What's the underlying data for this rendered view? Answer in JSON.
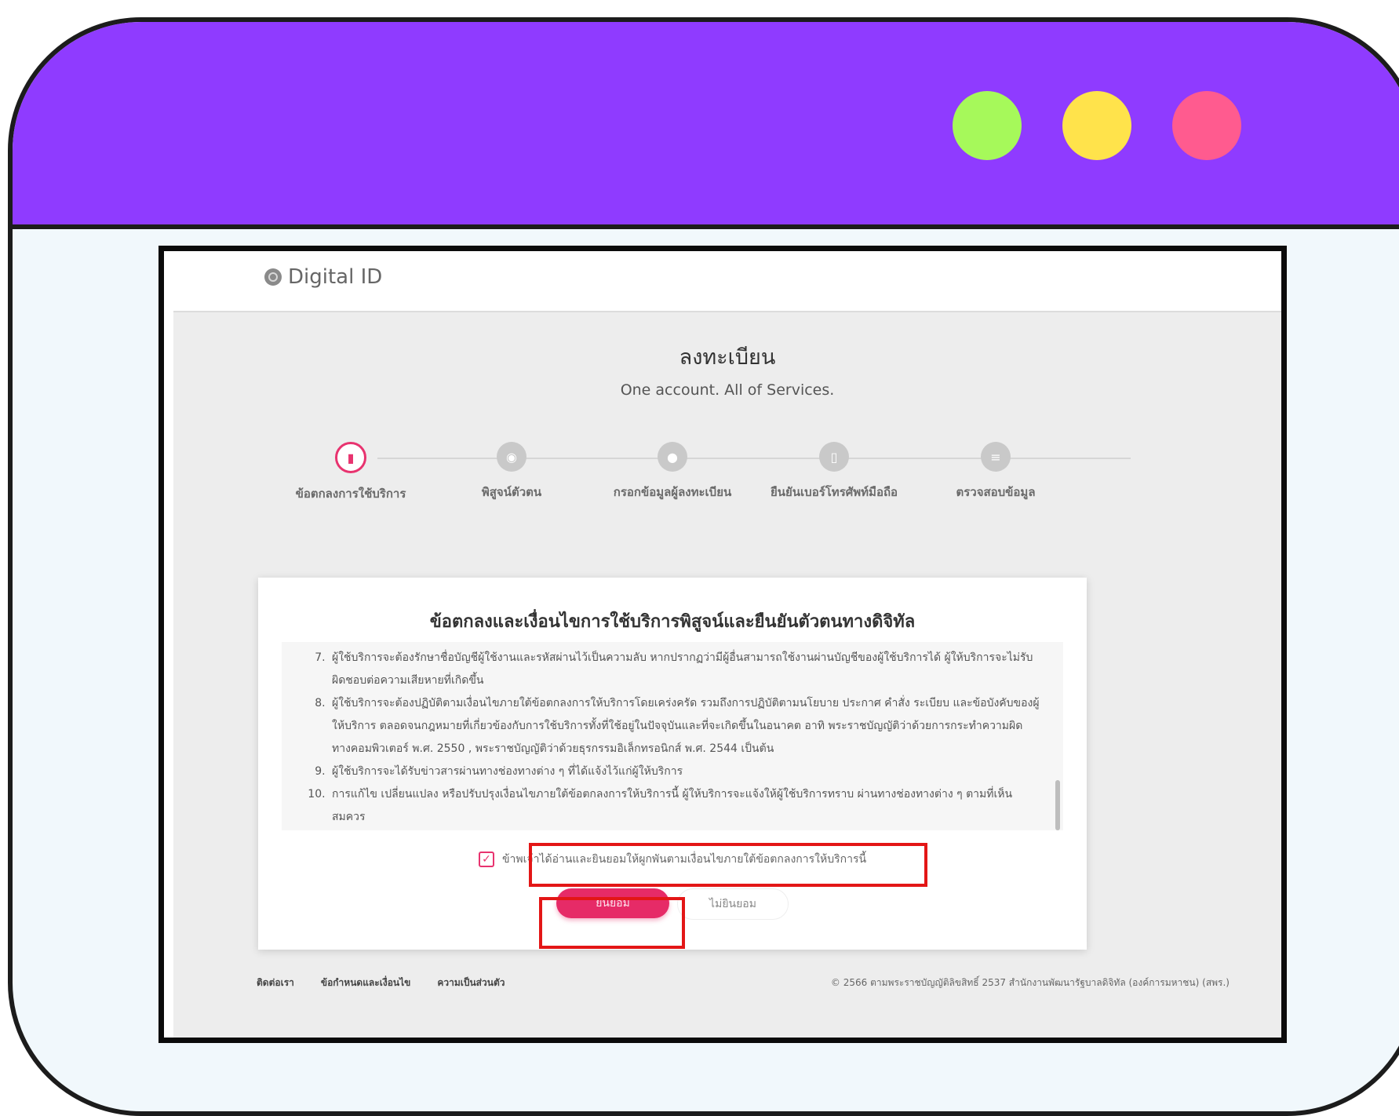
{
  "window": {
    "controls": [
      "green-dot",
      "yellow-dot",
      "pink-dot"
    ],
    "colors": {
      "titlebar": "#8f3bff",
      "green": "#a6f95a",
      "yellow": "#ffe34b",
      "pink": "#ff5b8f"
    }
  },
  "app": {
    "logo_text": "Digital ID"
  },
  "header": {
    "title": "ลงทะเบียน",
    "subtitle": "One account. All of Services."
  },
  "steps": [
    {
      "label": "ข้อตกลงการใช้บริการ",
      "icon": "document-icon",
      "active": true
    },
    {
      "label": "พิสูจน์ตัวตน",
      "icon": "fingerprint-icon",
      "active": false
    },
    {
      "label": "กรอกข้อมูลผู้ลงทะเบียน",
      "icon": "user-icon",
      "active": false
    },
    {
      "label": "ยืนยันเบอร์โทรศัพท์มือถือ",
      "icon": "phone-icon",
      "active": false
    },
    {
      "label": "ตรวจสอบข้อมูล",
      "icon": "checklist-icon",
      "active": false
    }
  ],
  "terms": {
    "title": "ข้อตกลงและเงื่อนไขการใช้บริการพิสูจน์และยืนยันตัวตนทางดิจิทัล",
    "items": [
      "ผู้ใช้บริการจะต้องรักษาชื่อบัญชีผู้ใช้งานและรหัสผ่านไว้เป็นความลับ หากปรากฏว่ามีผู้อื่นสามารถใช้งานผ่านบัญชีของผู้ใช้บริการได้ ผู้ให้บริการจะไม่รับผิดชอบต่อความเสียหายที่เกิดขึ้น",
      "ผู้ใช้บริการจะต้องปฏิบัติตามเงื่อนไขภายใต้ข้อตกลงการให้บริการโดยเคร่งครัด รวมถึงการปฏิบัติตามนโยบาย ประกาศ คำสั่ง ระเบียบ และข้อบังคับของผู้ให้บริการ ตลอดจนกฎหมายที่เกี่ยวข้องกับการใช้บริการทั้งที่ใช้อยู่ในปัจจุบันและที่จะเกิดขึ้นในอนาคต อาทิ พระราชบัญญัติว่าด้วยการกระทำความผิดทางคอมพิวเตอร์ พ.ศ. 2550 , พระราชบัญญัติว่าด้วยธุรกรรมอิเล็กทรอนิกส์ พ.ศ. 2544 เป็นต้น",
      "ผู้ใช้บริการจะได้รับข่าวสารผ่านทางช่องทางต่าง ๆ ที่ได้แจ้งไว้แก่ผู้ให้บริการ",
      "การแก้ไข เปลี่ยนแปลง หรือปรับปรุงเงื่อนไขภายใต้ข้อตกลงการให้บริการนี้ ผู้ให้บริการจะแจ้งให้ผู้ใช้บริการทราบ ผ่านทางช่องทางต่าง ๆ ตามที่เห็นสมควร"
    ],
    "start_number": 7
  },
  "consent": {
    "checkbox_label": "ข้าพเจ้าได้อ่านและยินยอมให้ผูกพันตามเงื่อนไขภายใต้ข้อตกลงการให้บริการนี้",
    "checked": true,
    "accept_label": "ยินยอม",
    "decline_label": "ไม่ยินยอม"
  },
  "footer": {
    "links": [
      "ติดต่อเรา",
      "ข้อกำหนดและเงื่อนไข",
      "ความเป็นส่วนตัว"
    ],
    "copyright": "© 2566 ตามพระราชบัญญัติลิขสิทธิ์ 2537 สำนักงานพัฒนารัฐบาลดิจิทัล (องค์การมหาชน) (สพร.)"
  },
  "colors": {
    "accent": "#e62b67",
    "highlight": "#e31616"
  }
}
